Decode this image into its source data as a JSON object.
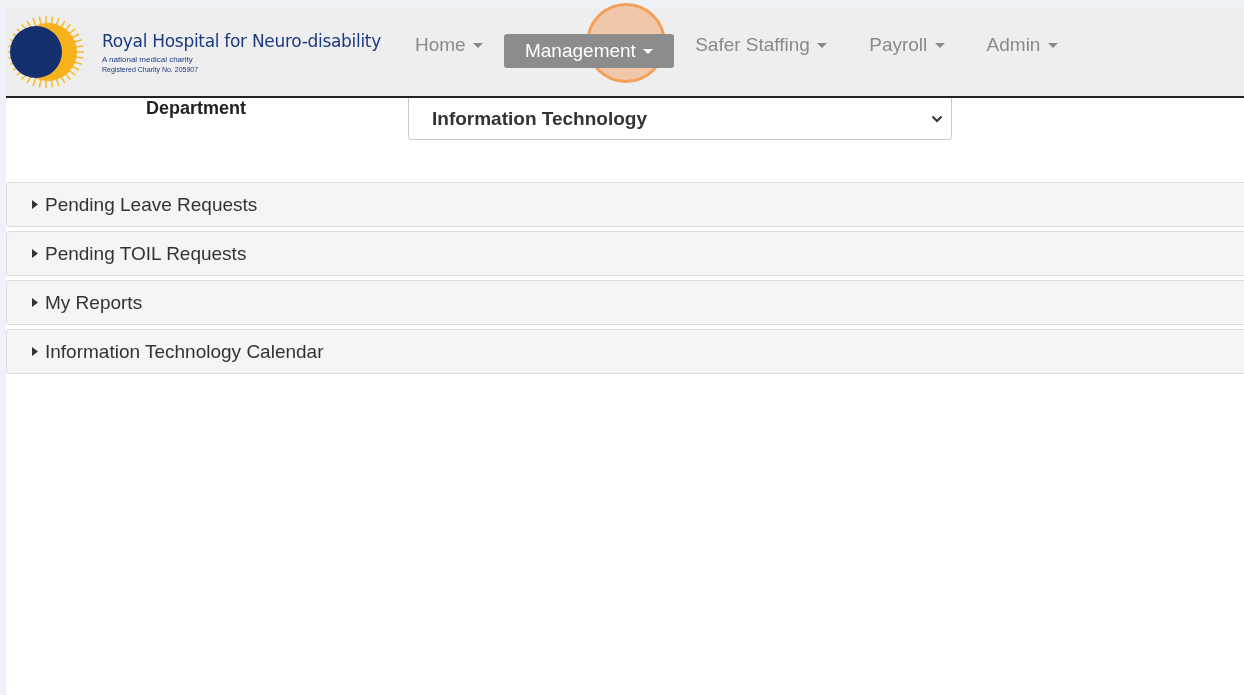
{
  "brand": {
    "name": "Royal Hospital for Neuro-disability",
    "tagline": "A national medical charity",
    "registration": "Registered Charity No. 205907"
  },
  "nav": [
    {
      "label": "Home",
      "selected": false
    },
    {
      "label": "Management",
      "selected": true
    },
    {
      "label": "Safer Staffing",
      "selected": false
    },
    {
      "label": "Payroll",
      "selected": false
    },
    {
      "label": "Admin",
      "selected": false
    }
  ],
  "department": {
    "label": "Department",
    "value": "Information Technology"
  },
  "panels": [
    {
      "title": "Pending Leave Requests",
      "expanded": false
    },
    {
      "title": "Pending TOIL Requests",
      "expanded": false
    },
    {
      "title": "My Reports",
      "expanded": false
    },
    {
      "title": "Information Technology Calendar",
      "expanded": false
    }
  ]
}
